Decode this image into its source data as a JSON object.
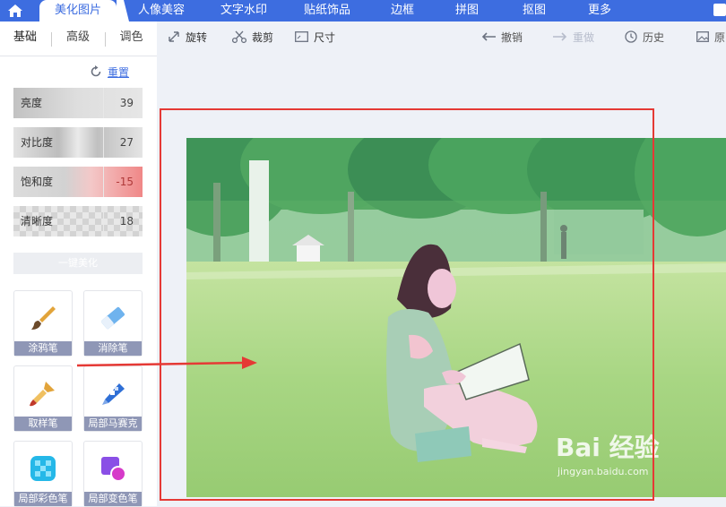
{
  "nav": {
    "tabs": [
      "美化图片",
      "人像美容",
      "文字水印",
      "贴纸饰品",
      "边框",
      "拼图",
      "抠图",
      "更多"
    ],
    "active_index": 0
  },
  "panel": {
    "subtabs": [
      "基础",
      "高级",
      "调色"
    ],
    "active_subtab": 0,
    "reset_label": "重置",
    "sliders": [
      {
        "name": "亮度",
        "value": "39"
      },
      {
        "name": "对比度",
        "value": "27"
      },
      {
        "name": "饱和度",
        "value": "-15"
      },
      {
        "name": "清晰度",
        "value": "18"
      }
    ],
    "one_key_label": "一键美化",
    "tools": [
      {
        "label": "涂鸦笔",
        "icon": "brush-icon"
      },
      {
        "label": "消除笔",
        "icon": "eraser-icon"
      },
      {
        "label": "取样笔",
        "icon": "sample-brush-icon"
      },
      {
        "label": "局部马赛克",
        "icon": "mosaic-pen-icon"
      },
      {
        "label": "局部彩色笔",
        "icon": "color-pen-icon"
      },
      {
        "label": "局部变色笔",
        "icon": "recolor-pen-icon"
      }
    ]
  },
  "toolbar": {
    "rotate": "旋转",
    "crop": "裁剪",
    "size": "尺寸",
    "undo": "撤销",
    "redo": "重做",
    "history": "历史",
    "original": "原"
  },
  "watermark": {
    "brand": "Bai 经验",
    "url": "jingyan.baidu.com"
  },
  "colors": {
    "accent": "#3d6de0",
    "annotation_red": "#e53935"
  }
}
